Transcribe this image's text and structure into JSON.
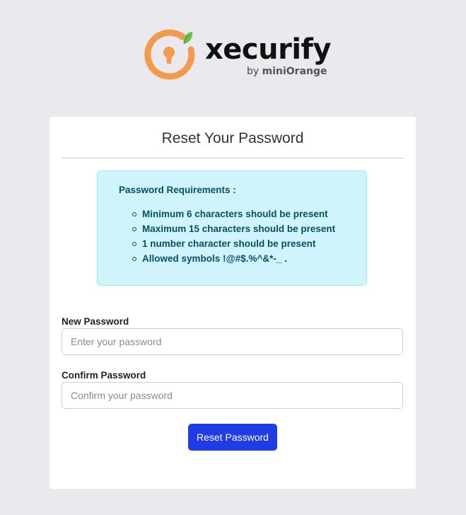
{
  "logo": {
    "wordmark": "xecurify",
    "byline_prefix": "by ",
    "byline_brand": "miniOrange"
  },
  "card": {
    "title": "Reset Your Password"
  },
  "requirements": {
    "title": "Password Requirements :",
    "items": [
      "Minimum 6 characters should be present",
      "Maximum 15 characters should be present",
      "1 number character should be present",
      "Allowed symbols !@#$.%^&*-_ ."
    ]
  },
  "form": {
    "new_password": {
      "label": "New Password",
      "value": "",
      "placeholder": "Enter your password"
    },
    "confirm_password": {
      "label": "Confirm Password",
      "value": "",
      "placeholder": "Confirm your password"
    },
    "submit_label": "Reset Password"
  },
  "colors": {
    "page_background": "#e9e9ee",
    "logo_orange": "#f39a4d",
    "logo_leaf": "#6fbf4a",
    "info_background": "#cff4fc",
    "info_text": "#055160",
    "button_primary": "#1f3ce6"
  },
  "icons": {
    "logo_mark": "keyhole-ring-with-leaf-icon"
  }
}
